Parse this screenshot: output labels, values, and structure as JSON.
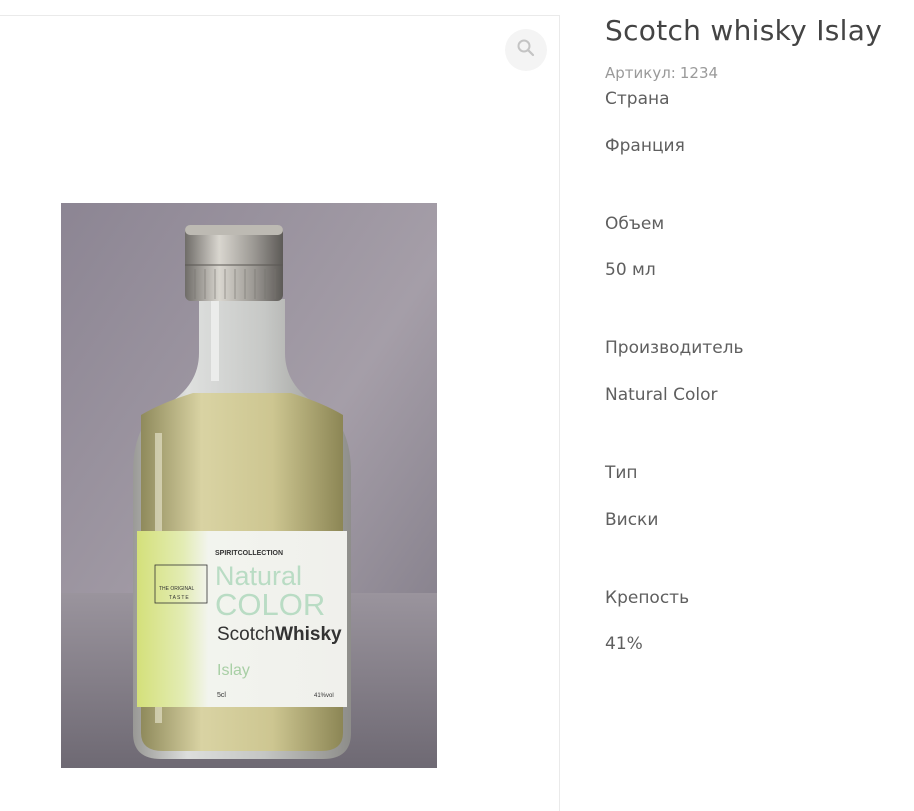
{
  "product": {
    "title": "Scotch whisky Islay",
    "sku_label": "Артикул:",
    "sku_value": "1234",
    "image_alt": "Scotch whisky Islay"
  },
  "attributes": [
    {
      "label": "Страна",
      "value": "Франция"
    },
    {
      "label": "Объем",
      "value": "50 мл"
    },
    {
      "label": "Производитель",
      "value": "Natural Color"
    },
    {
      "label": "Тип",
      "value": "Виски"
    },
    {
      "label": "Крепость",
      "value": "41%"
    }
  ],
  "bottle_label": {
    "brand_small_1": "SPIRIT",
    "brand_small_2": "COLLECTION",
    "line1": "Natural",
    "line2": "COLOR",
    "line3a": "Scotch",
    "line3b": "Whisky",
    "line4": "Islay",
    "volume": "5cl",
    "abv": "41%vol",
    "stamp1": "THE ORIGINAL",
    "stamp2": "TASTE"
  },
  "icons": {
    "zoom": "magnifier-icon"
  },
  "colors": {
    "title": "#444444",
    "muted": "#9a9a9a",
    "text": "#5f5f5f",
    "divider": "#eaeaea"
  }
}
